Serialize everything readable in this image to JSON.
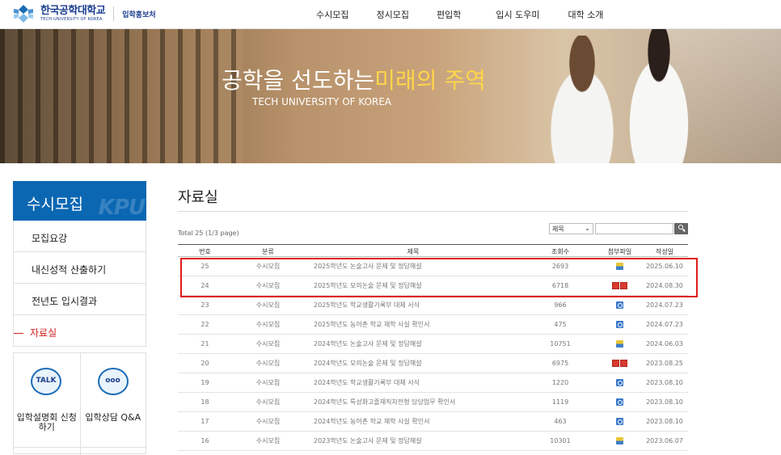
{
  "header": {
    "logo_kr": "한국공학대학교",
    "logo_en": "TECH UNIVERSITY OF KOREA",
    "logo_sub": "입학홍보처",
    "nav": [
      "수시모집",
      "정시모집",
      "편입학",
      "입시 도우미",
      "대학 소개"
    ]
  },
  "banner": {
    "title_main": "공학을 선도하는",
    "title_highlight": "미래의 주역",
    "subtitle": "TECH UNIVERSITY OF KOREA"
  },
  "sidebar": {
    "title": "수시모집",
    "watermark": "KPU",
    "items": [
      {
        "label": "모집요강",
        "active": false
      },
      {
        "label": "내신성적 산출하기",
        "active": false
      },
      {
        "label": "전년도 입시결과",
        "active": false
      },
      {
        "label": "자료실",
        "active": true
      }
    ],
    "quick": [
      {
        "icon": "talk-bubble-icon",
        "icon_text": "TALK",
        "label_l1": "입학설명회 신청",
        "label_l2": "하기"
      },
      {
        "icon": "chat-bubble-icon",
        "icon_text": "ooo",
        "label_l1": "입학상담 Q&A",
        "label_l2": ""
      }
    ]
  },
  "content": {
    "title": "자료실",
    "total": "Total 25 (1/3 page)",
    "search": {
      "select_value": "제목",
      "input_value": ""
    },
    "columns": [
      "번호",
      "분류",
      "제목",
      "조회수",
      "첨부파일",
      "작성일"
    ],
    "rows": [
      {
        "no": "25",
        "cat": "수시모집",
        "subject": "2025학년도 논술고사 문제 및 정답해설",
        "views": "2693",
        "files": [
          "zip-file-icon"
        ],
        "date": "2025.06.10"
      },
      {
        "no": "24",
        "cat": "수시모집",
        "subject": "2025학년도 모의논술 문제 및 정답해설",
        "views": "6718",
        "files": [
          "pdf-file-icon",
          "pdf-file-icon"
        ],
        "date": "2024.08.30"
      },
      {
        "no": "23",
        "cat": "수시모집",
        "subject": "2025학년도 학교생활기록부 대체 서식",
        "views": "966",
        "files": [
          "hwp-file-icon"
        ],
        "date": "2024.07.23"
      },
      {
        "no": "22",
        "cat": "수시모집",
        "subject": "2025학년도 농어촌 학교 재학 사실 확인서",
        "views": "475",
        "files": [
          "hwp-file-icon"
        ],
        "date": "2024.07.23"
      },
      {
        "no": "21",
        "cat": "수시모집",
        "subject": "2024학년도 논술고사 문제 및 정답해설",
        "views": "10751",
        "files": [
          "zip-file-icon"
        ],
        "date": "2024.06.03"
      },
      {
        "no": "20",
        "cat": "수시모집",
        "subject": "2024학년도 모의논술 문제 및 정답해설",
        "views": "6975",
        "files": [
          "pdf-file-icon",
          "pdf-file-icon"
        ],
        "date": "2023.08.25"
      },
      {
        "no": "19",
        "cat": "수시모집",
        "subject": "2024학년도 학교생활기록부 대체 서식",
        "views": "1220",
        "files": [
          "hwp-file-icon"
        ],
        "date": "2023.08.10"
      },
      {
        "no": "18",
        "cat": "수시모집",
        "subject": "2024학년도 특성화고졸재직자전형 담당업무 확인서",
        "views": "1119",
        "files": [
          "hwp-file-icon"
        ],
        "date": "2023.08.10"
      },
      {
        "no": "17",
        "cat": "수시모집",
        "subject": "2024학년도 농어촌 학교 재학 사실 확인서",
        "views": "463",
        "files": [
          "hwp-file-icon"
        ],
        "date": "2023.08.10"
      },
      {
        "no": "16",
        "cat": "수시모집",
        "subject": "2023학년도 논술고사 문제 및 정답해설",
        "views": "10301",
        "files": [
          "zip-file-icon"
        ],
        "date": "2023.06.07"
      }
    ]
  },
  "colors": {
    "brand_blue": "#0b67b2",
    "active_red": "#d21f1f",
    "highlight_red": "#e01a1a",
    "banner_yellow": "#ffd54a"
  }
}
